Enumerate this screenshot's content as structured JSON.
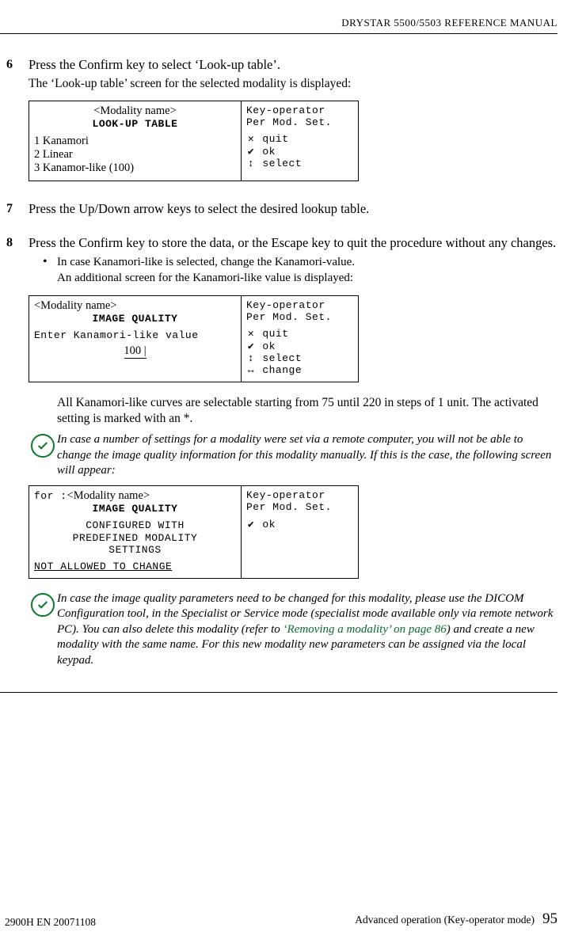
{
  "header": {
    "title": "DRYSTAR 5500/5503 REFERENCE MANUAL"
  },
  "steps": {
    "s6": {
      "num": "6",
      "title": "Press the Confirm key to select ‘Look-up table’.",
      "desc": "The ‘Look-up table’ screen for the selected modality is displayed:"
    },
    "s7": {
      "num": "7",
      "title": "Press the Up/Down arrow keys to select the desired lookup table."
    },
    "s8": {
      "num": "8",
      "title": "Press the Confirm key to store the data, or the Escape key to quit the procedure without any changes.",
      "bullet": "In case Kanamori-like is selected, change the Kanamori-value.",
      "bullet_desc": "An additional screen for the Kanamori-like value is displayed:",
      "post1": "All Kanamori-like curves are selectable starting from 75 until 220 in steps of 1 unit. The activated setting is marked with an *."
    }
  },
  "screens": {
    "modality_placeholder": "<Modality name>",
    "lut": {
      "title": "LOOK-UP TABLE",
      "items": {
        "i1": "1 Kanamori",
        "i2": "2 Linear",
        "i3": "3 Kanamor-like (100)"
      }
    },
    "right_generic": {
      "l1": "Key-operator",
      "l2": "Per Mod. Set."
    },
    "right_cmds": {
      "quit": "quit",
      "ok": "ok",
      "select": "select",
      "change": "change"
    },
    "kanamori": {
      "title": "IMAGE QUALITY",
      "prompt": "Enter Kanamori-like value",
      "value": "100"
    },
    "locked": {
      "for_label": "for :",
      "title": "IMAGE QUALITY",
      "l1": "CONFIGURED WITH",
      "l2": "PREDEFINED MODALITY",
      "l3": "SETTINGS",
      "l4": "NOT ALLOWED TO CHANGE"
    }
  },
  "notes": {
    "n1": "In case a number of settings for a modality were set via a remote computer, you will not be able to change the image quality information for this modality manually. If this is the case, the following screen will appear:",
    "n2a": "In case the image quality parameters need to be changed for this modality, please use the DICOM Configuration tool, in the Specialist or Service mode (specialist mode available only via remote network PC). You can also delete this modality (refer to ",
    "n2_link": "‘Removing a modality’ on page 86",
    "n2b": ") and create a new modality with the same name. For this new modality new parameters can be assigned via the local keypad."
  },
  "footer": {
    "left": "2900H EN 20071108",
    "right": "Advanced operation (Key-operator mode)",
    "page": "95"
  }
}
